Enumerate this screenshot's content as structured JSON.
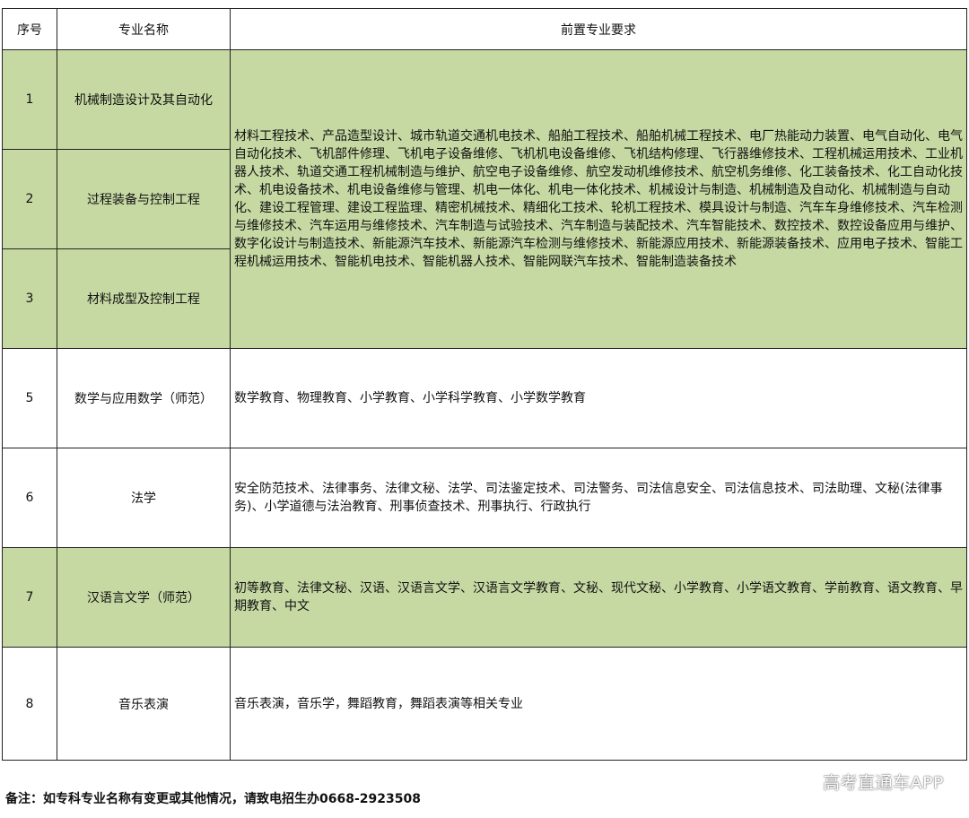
{
  "table": {
    "headers": {
      "index": "序号",
      "major": "专业名称",
      "requirement": "前置专业要求"
    },
    "rows": [
      {
        "index": "1",
        "major": "机械制造设计及其自动化"
      },
      {
        "index": "2",
        "major": "过程装备与控制工程"
      },
      {
        "index": "3",
        "major": "材料成型及控制工程"
      },
      {
        "index": "5",
        "major": "数学与应用数学（师范）",
        "requirement": "数学教育、物理教育、小学教育、小学科学教育、小学数学教育"
      },
      {
        "index": "6",
        "major": "法学",
        "requirement": "安全防范技术、法律事务、法律文秘、法学、司法鉴定技术、司法警务、司法信息安全、司法信息技术、司法助理、文秘(法律事务)、小学道德与法治教育、刑事侦查技术、刑事执行、行政执行"
      },
      {
        "index": "7",
        "major": "汉语言文学（师范）",
        "requirement": "初等教育、法律文秘、汉语、汉语言文学、汉语言文学教育、文秘、现代文秘、小学教育、小学语文教育、学前教育、语文教育、早期教育、中文"
      },
      {
        "index": "8",
        "major": "音乐表演",
        "requirement": "音乐表演，音乐学，舞蹈教育，舞蹈表演等相关专业"
      }
    ],
    "merged_requirement_1_3": "材料工程技术、产品造型设计、城市轨道交通机电技术、船舶工程技术、船舶机械工程技术、电厂热能动力装置、电气自动化、电气自动化技术、飞机部件修理、飞机电子设备维修、飞机机电设备维修、飞机结构修理、飞行器维修技术、工程机械运用技术、工业机器人技术、轨道交通工程机械制造与维护、航空电子设备维修、航空发动机维修技术、航空机务维修、化工装备技术、化工自动化技术、机电设备技术、机电设备维修与管理、机电一体化、机电一体化技术、机械设计与制造、机械制造及自动化、机械制造与自动化、建设工程管理、建设工程监理、精密机械技术、精细化工技术、轮机工程技术、模具设计与制造、汽车车身维修技术、汽车检测与维修技术、汽车运用与维修技术、汽车制造与试验技术、汽车制造与装配技术、汽车智能技术、数控技术、数控设备应用与维护、数字化设计与制造技术、新能源汽车技术、新能源汽车检测与维修技术、新能源应用技术、新能源装备技术、应用电子技术、智能工程机械运用技术、智能机电技术、智能机器人技术、智能网联汽车技术、智能制造装备技术",
    "colors": {
      "green_row": "#c6d9a3",
      "white_row": "#ffffff",
      "border": "#222222"
    }
  },
  "footer": {
    "note": "备注：如专科专业名称有变更或其他情况，请致电招生办0668-2923508"
  },
  "watermark": {
    "text": "高考直通车APP"
  }
}
